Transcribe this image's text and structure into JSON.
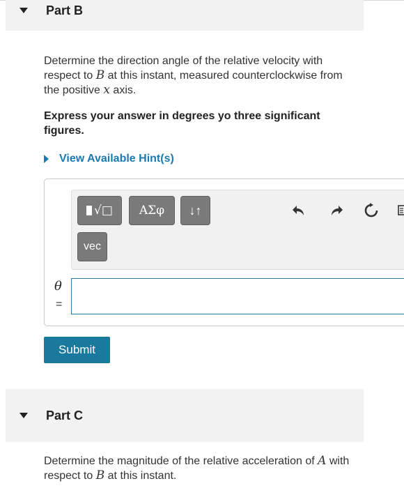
{
  "partB": {
    "title": "Part B",
    "q1": "Determine the direction angle of the relative velocity with respect to ",
    "q1_sym": "B",
    "q1_mid": " at this instant, measured counterclockwise from the positive ",
    "q1_sym2": "x",
    "q1_end": " axis.",
    "instruction": "Express your answer in degrees yo three significant figures.",
    "hint_label": "View Available Hint(s)",
    "toolbar": {
      "templates_label": "√□",
      "greek_label": "ΑΣφ",
      "arrows_label": "↓↑",
      "vec_label": "vec"
    },
    "variable": "θ",
    "equals": "=",
    "input_value": "",
    "submit_label": "Submit"
  },
  "partC": {
    "title": "Part C",
    "q1": "Determine the magnitude of the relative acceleration of ",
    "q1_sym": "A",
    "q1_mid": " with respect to ",
    "q1_sym2": "B",
    "q1_end": " at this instant."
  },
  "colors": {
    "accent": "#1a7ab0",
    "submit_bg": "#1a7a9e",
    "toolbar_button": "#7a7a7a",
    "header_bg": "#f2f2f2"
  }
}
